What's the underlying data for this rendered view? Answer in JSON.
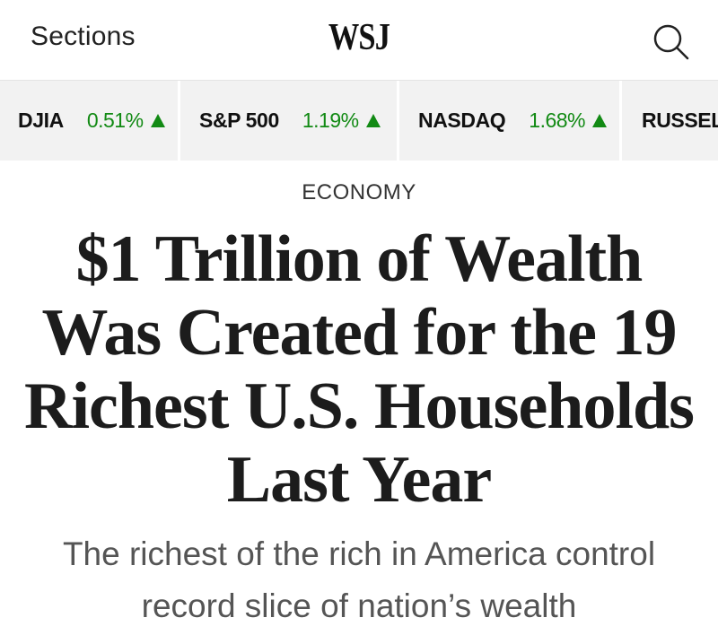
{
  "header": {
    "sections_label": "Sections",
    "logo_text": "WSJ",
    "search_icon": "search-icon"
  },
  "ticker": [
    {
      "name": "DJIA",
      "change": "0.51%",
      "direction": "up"
    },
    {
      "name": "S&P 500",
      "change": "1.19%",
      "direction": "up"
    },
    {
      "name": "NASDAQ",
      "change": "1.68%",
      "direction": "up"
    },
    {
      "name": "RUSSELL",
      "change": "",
      "direction": "up"
    }
  ],
  "article": {
    "kicker": "ECONOMY",
    "headline": "$1 Trillion of Wealth Was Created for the 19 Richest U.S. Households Last Year",
    "subhead": "The richest of the rich in America control record slice of nation’s wealth"
  },
  "colors": {
    "up": "#128a14",
    "ticker_bg": "#f2f2f2",
    "headline": "#1c1c1c",
    "subhead": "#555555"
  }
}
